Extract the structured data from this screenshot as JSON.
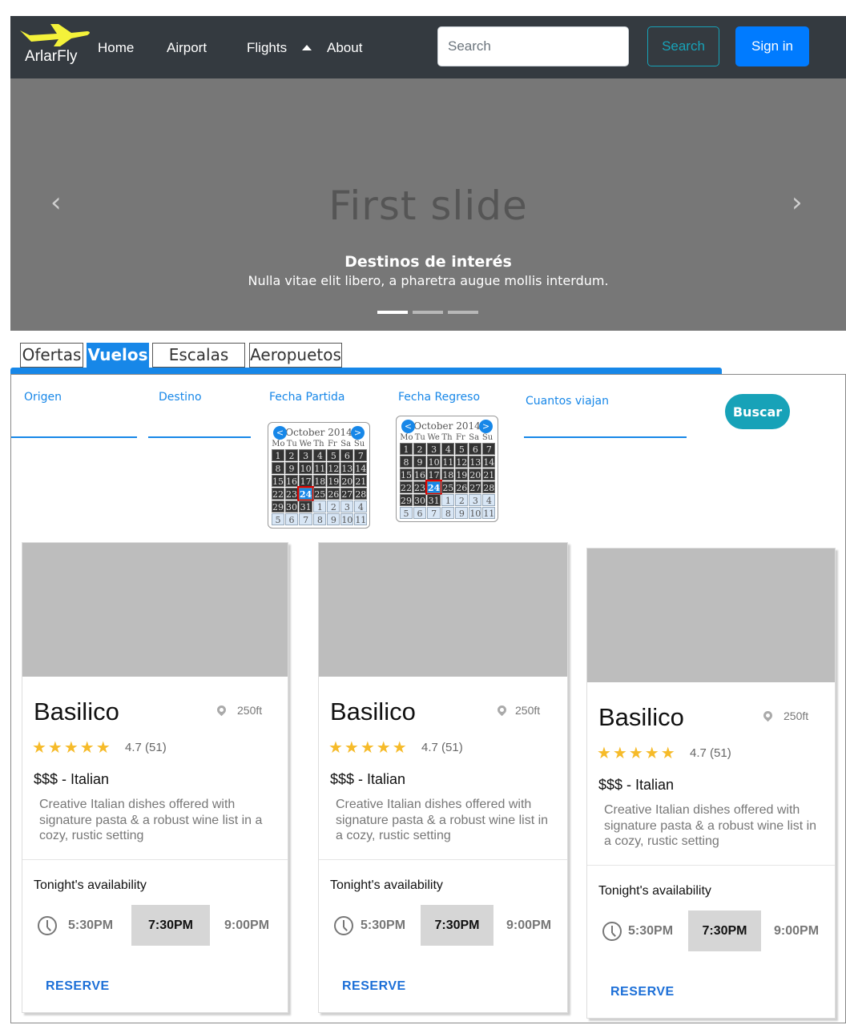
{
  "navbar": {
    "brand": "ArlarFly",
    "links": [
      "Home",
      "Airport",
      "Flights",
      "About"
    ],
    "search_placeholder": "Search",
    "search_button": "Search",
    "signin_button": "Sign in"
  },
  "carousel": {
    "slide_text": "First slide",
    "caption_title": "Destinos de interés",
    "caption_text": "Nulla vitae elit libero, a pharetra augue mollis interdum.",
    "prev_icon": "‹",
    "next_icon": "›",
    "indicator_count": 3,
    "active_indicator": 0
  },
  "tabs": [
    "Ofertas",
    "Vuelos",
    "Escalas",
    "Aeropuetos"
  ],
  "active_tab": "Vuelos",
  "search_form": {
    "origen": "Origen",
    "destino": "Destino",
    "fecha_partida": "Fecha Partida",
    "fecha_regreso": "Fecha Regreso",
    "cuantos": "Cuantos viajan",
    "buscar": "Buscar"
  },
  "calendar": {
    "month": "October 2014",
    "prev": "<",
    "next": ">",
    "weekdays": [
      "Mo",
      "Tu",
      "We",
      "Th",
      "Fr",
      "Sa",
      "Su"
    ],
    "weeks": [
      [
        "1",
        "2",
        "3",
        "4",
        "5",
        "6",
        "7"
      ],
      [
        "8",
        "9",
        "10",
        "11",
        "12",
        "13",
        "14"
      ],
      [
        "15",
        "16",
        "17",
        "18",
        "19",
        "20",
        "21"
      ],
      [
        "22",
        "23",
        "24",
        "25",
        "26",
        "27",
        "28"
      ],
      [
        "29",
        "30",
        "31",
        "1",
        "2",
        "3",
        "4"
      ],
      [
        "5",
        "6",
        "7",
        "8",
        "9",
        "10",
        "11"
      ]
    ],
    "selected_day": "24"
  },
  "cards": [
    {
      "title": "Basilico",
      "distance": "250ft",
      "stars": "★★★★★",
      "rating": "4.7 (51)",
      "price": "$$$ - Italian",
      "description": "Creative Italian dishes offered with signature pasta & a robust wine list in a cozy, rustic setting",
      "availability_title": "Tonight's availability",
      "times": [
        "5:30PM",
        "7:30PM",
        "9:00PM"
      ],
      "reserve": "RESERVE"
    },
    {
      "title": "Basilico",
      "distance": "250ft",
      "stars": "★★★★★",
      "rating": "4.7 (51)",
      "price": "$$$ - Italian",
      "description": "Creative Italian dishes offered with signature pasta & a robust wine list in a cozy, rustic setting",
      "availability_title": "Tonight's availability",
      "times": [
        "5:30PM",
        "7:30PM",
        "9:00PM"
      ],
      "reserve": "RESERVE"
    },
    {
      "title": "Basilico",
      "distance": "250ft",
      "stars": "★★★★★",
      "rating": "4.7 (51)",
      "price": "$$$ - Italian",
      "description": "Creative Italian dishes offered with signature pasta & a robust wine list in a cozy, rustic setting",
      "availability_title": "Tonight's availability",
      "times": [
        "5:30PM",
        "7:30PM",
        "9:00PM"
      ],
      "reserve": "RESERVE"
    }
  ],
  "colors": {
    "navbar": "#343a40",
    "carousel": "#777777",
    "primary": "#007bff",
    "tab_blue": "#1787e8",
    "info": "#17a2b8",
    "star": "#f6bb2a",
    "reserve": "#1c6fd7"
  },
  "icons": {
    "logo": "airplane-icon",
    "caret": "caret-up-icon",
    "pin": "map-pin-icon",
    "clock": "clock-icon",
    "star": "star-icon"
  }
}
